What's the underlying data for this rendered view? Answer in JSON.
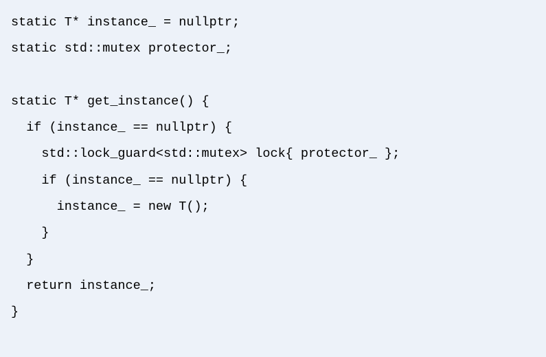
{
  "code": {
    "line1": "static T* instance_ = nullptr;",
    "line2": "static std::mutex protector_;",
    "line3": "",
    "line4": "static T* get_instance() {",
    "line5": "  if (instance_ == nullptr) {",
    "line6": "    std::lock_guard<std::mutex> lock{ protector_ };",
    "line7": "    if (instance_ == nullptr) {",
    "line8": "      instance_ = new T();",
    "line9": "    }",
    "line10": "  }",
    "line11": "  return instance_;",
    "line12": "}"
  }
}
